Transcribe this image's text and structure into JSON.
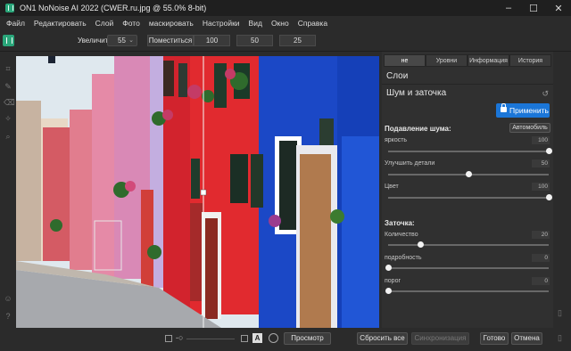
{
  "window": {
    "title": "ON1 NoNoise AI 2022 (CWER.ru.jpg @ 55.0% 8-bit)",
    "controls": [
      "–",
      "☐",
      "✕"
    ]
  },
  "menu": [
    "Файл",
    "Редактировать",
    "Слой",
    "Фото",
    "маскировать",
    "Настройки",
    "Вид",
    "Окно",
    "Справка"
  ],
  "toolbar": {
    "zoom_label": "Увеличить",
    "zoom_value": "55",
    "zoom_buttons": [
      "Поместиться",
      "100",
      "50",
      "25"
    ]
  },
  "panel": {
    "tabs": [
      "не",
      "Уровни",
      "Информация",
      "История"
    ],
    "layers_title": "Слои",
    "section_title": "Шум и заточка",
    "apply_label": "Применить",
    "noise": {
      "title": "Подавление шума:",
      "auto_label": "Автомобиль",
      "sliders": [
        {
          "label": "яркость",
          "value": "100",
          "fraction": 1.0
        },
        {
          "label": "Улучшить детали",
          "value": "50",
          "fraction": 0.5
        },
        {
          "label": "Цвет",
          "value": "100",
          "fraction": 1.0
        }
      ]
    },
    "sharpen": {
      "title": "Заточка:",
      "sliders": [
        {
          "label": "Количество",
          "value": "20",
          "fraction": 0.2
        },
        {
          "label": "подробность",
          "value": "0",
          "fraction": 0.0
        },
        {
          "label": "порог",
          "value": "0",
          "fraction": 0.0
        }
      ]
    }
  },
  "bottom": {
    "preview_label": "Просмотр",
    "reset_all_label": "Сбросить все",
    "sync_label": "Синхронизация",
    "done_label": "Готово",
    "cancel_label": "Отмена",
    "view_label": "A"
  },
  "colors": {
    "accent": "#1b76d8",
    "brand": "#2aa67a",
    "panel_bg": "#303030"
  }
}
